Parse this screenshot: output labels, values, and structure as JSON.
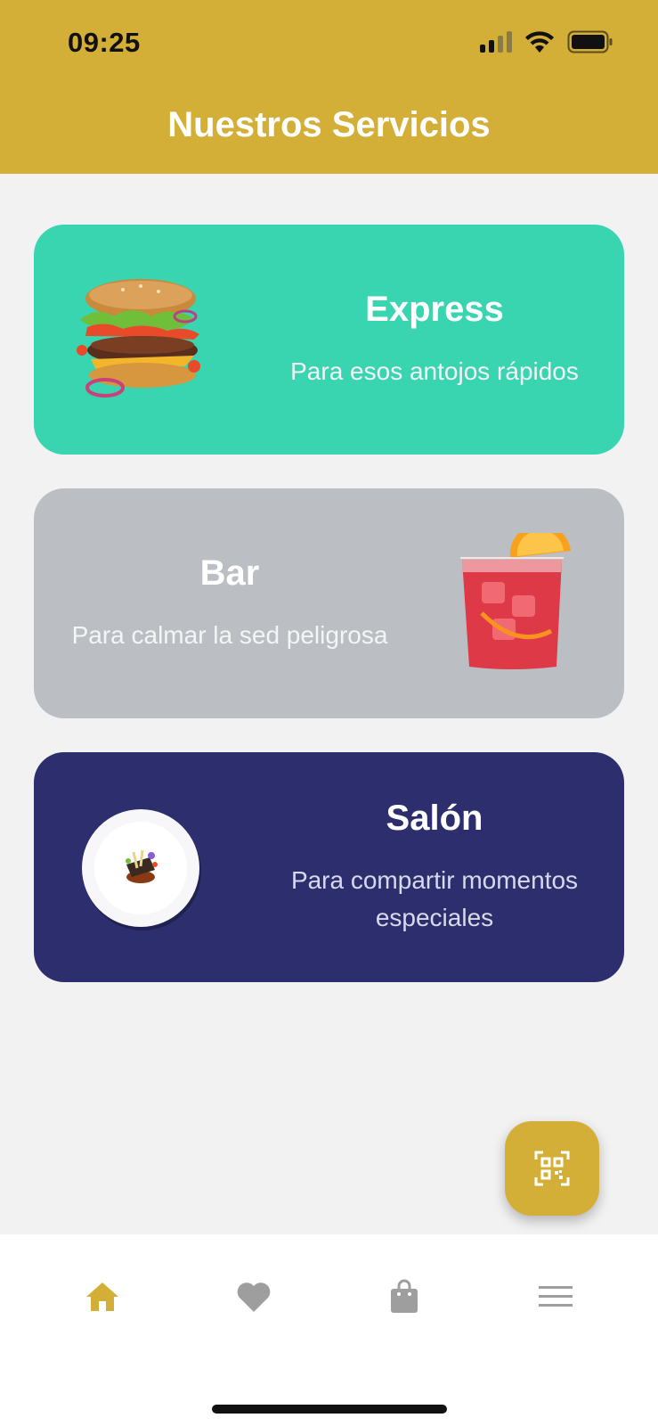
{
  "status_bar": {
    "time": "09:25",
    "icons": [
      "signal-icon",
      "wifi-icon",
      "battery-icon"
    ]
  },
  "header": {
    "title": "Nuestros Servicios",
    "background": "#d4af37"
  },
  "services": [
    {
      "title": "Express",
      "subtitle": "Para esos antojos rápidos",
      "image": "burger-image",
      "color": "#39d4b0"
    },
    {
      "title": "Bar",
      "subtitle": "Para calmar la sed peligrosa",
      "image": "cocktail-image",
      "color": "#bbbfc3"
    },
    {
      "title": "Salón",
      "subtitle": "Para compartir momentos especiales",
      "image": "plated-dish-image",
      "color": "#2c2e6e"
    }
  ],
  "fab": {
    "icon": "qr-code-icon"
  },
  "bottom_nav": {
    "items": [
      {
        "icon": "home-icon",
        "active": true
      },
      {
        "icon": "heart-icon",
        "active": false
      },
      {
        "icon": "shopping-bag-icon",
        "active": false
      },
      {
        "icon": "menu-icon",
        "active": false
      }
    ],
    "active_color": "#d4af37",
    "inactive_color": "#9e9e9e"
  }
}
